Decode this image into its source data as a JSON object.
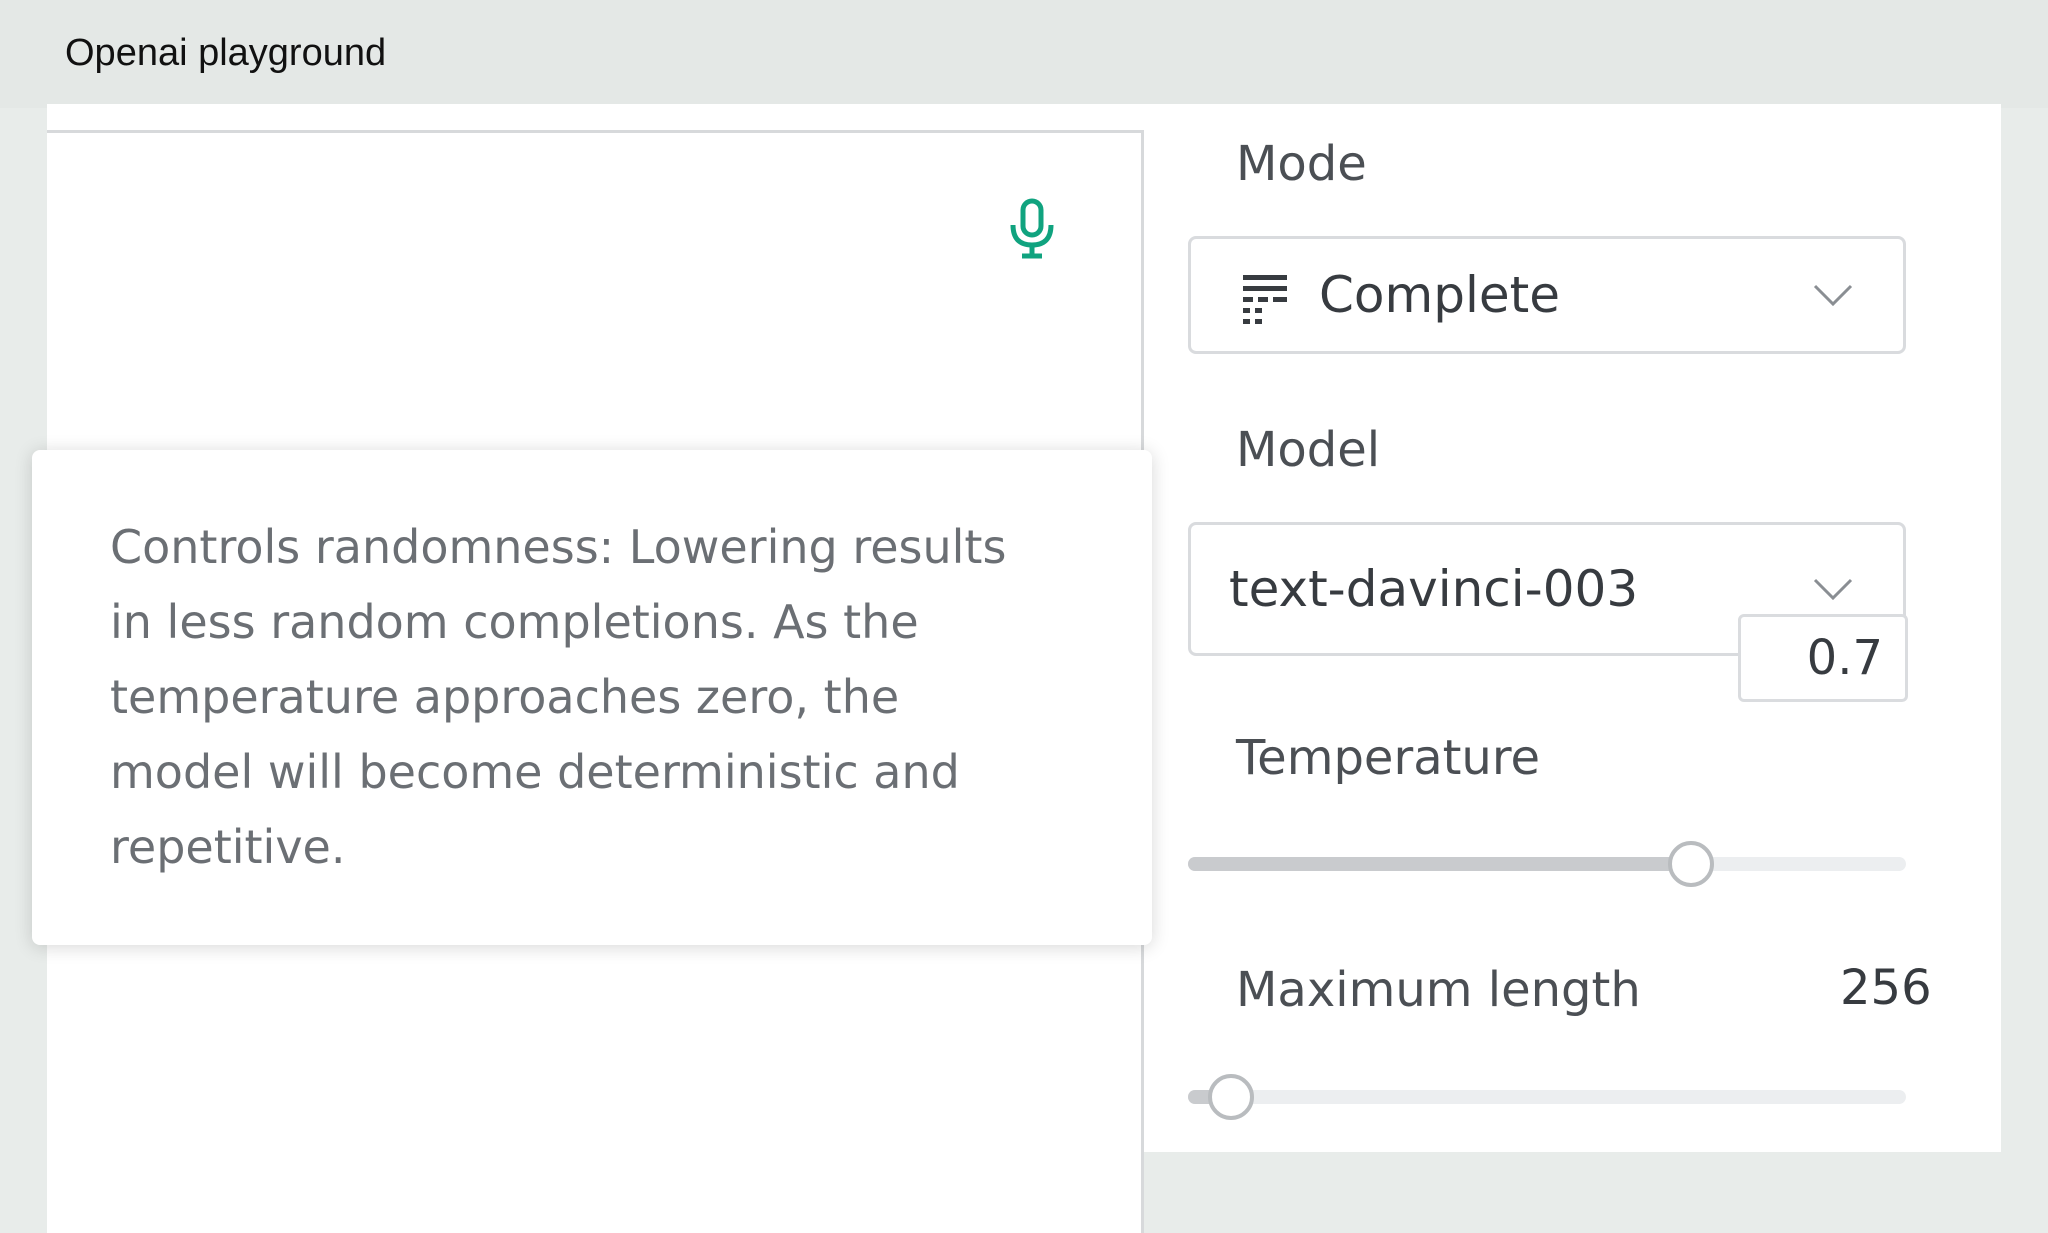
{
  "header": {
    "title": "Openai playground"
  },
  "tooltip": {
    "lines": [
      "Controls randomness: Lowering results",
      "in less random completions. As the",
      "temperature approaches zero, the",
      "model will become deterministic and",
      "repetitive."
    ]
  },
  "settings": {
    "mode": {
      "label": "Mode",
      "value": "Complete",
      "icon": "complete-icon"
    },
    "model": {
      "label": "Model",
      "value": "text-davinci-003"
    },
    "temperature": {
      "label": "Temperature",
      "value": "0.7",
      "level": 0.7
    },
    "max_length": {
      "label": "Maximum length",
      "value": "256",
      "level": 0.06
    }
  },
  "colors": {
    "mic": "#10a37f"
  }
}
